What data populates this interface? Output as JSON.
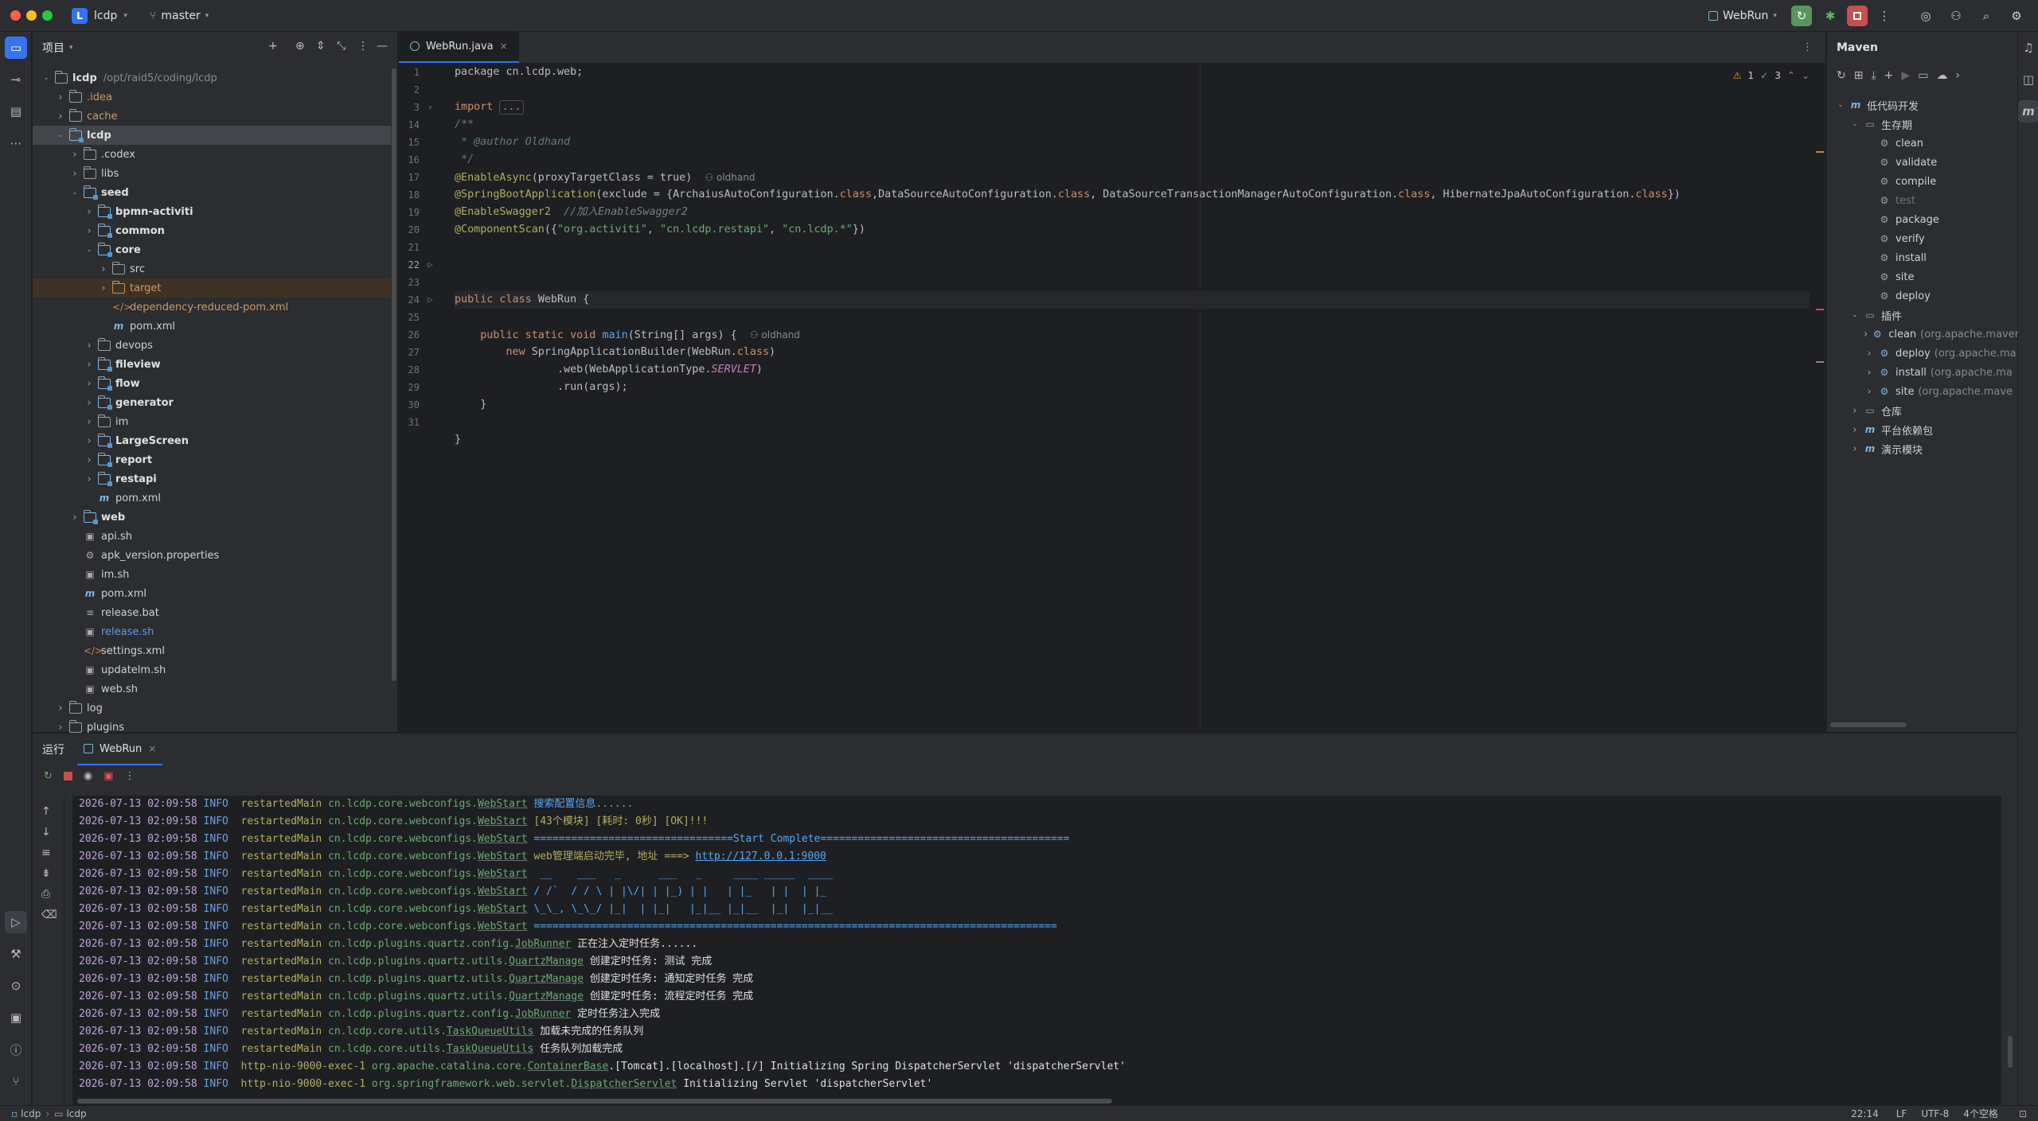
{
  "titlebar": {
    "project_badge": "L",
    "project": "lcdp",
    "branch": "master",
    "run_config": "WebRun"
  },
  "project_panel": {
    "title": "项目"
  },
  "tree": [
    {
      "d": 0,
      "a": "v",
      "t": "dir",
      "label": "lcdp",
      "path": "/opt/raid5/coding/lcdp",
      "b": true
    },
    {
      "d": 1,
      "a": ">",
      "t": "dir",
      "label": ".idea",
      "c": "orange"
    },
    {
      "d": 1,
      "a": ">",
      "t": "dir",
      "label": "cache",
      "c": "orange"
    },
    {
      "d": 1,
      "a": "v",
      "t": "mod",
      "label": "lcdp",
      "b": true,
      "sel": true
    },
    {
      "d": 2,
      "a": ">",
      "t": "dir",
      "label": ".codex"
    },
    {
      "d": 2,
      "a": ">",
      "t": "dir",
      "label": "libs"
    },
    {
      "d": 2,
      "a": "v",
      "t": "mod",
      "label": "seed",
      "b": true
    },
    {
      "d": 3,
      "a": ">",
      "t": "mod",
      "label": "bpmn-activiti",
      "b": true
    },
    {
      "d": 3,
      "a": ">",
      "t": "mod",
      "label": "common",
      "b": true
    },
    {
      "d": 3,
      "a": "v",
      "t": "mod",
      "label": "core",
      "b": true
    },
    {
      "d": 4,
      "a": ">",
      "t": "dir",
      "label": "src"
    },
    {
      "d": 4,
      "a": ">",
      "t": "tgt",
      "label": "target",
      "c": "orange",
      "hl": true
    },
    {
      "d": 4,
      "a": "",
      "t": "xml",
      "label": "dependency-reduced-pom.xml",
      "c": "orange"
    },
    {
      "d": 4,
      "a": "",
      "t": "pom",
      "label": "pom.xml"
    },
    {
      "d": 3,
      "a": ">",
      "t": "dir",
      "label": "devops"
    },
    {
      "d": 3,
      "a": ">",
      "t": "mod",
      "label": "fileview",
      "b": true
    },
    {
      "d": 3,
      "a": ">",
      "t": "mod",
      "label": "flow",
      "b": true
    },
    {
      "d": 3,
      "a": ">",
      "t": "mod",
      "label": "generator",
      "b": true
    },
    {
      "d": 3,
      "a": ">",
      "t": "dir",
      "label": "im"
    },
    {
      "d": 3,
      "a": ">",
      "t": "mod",
      "label": "LargeScreen",
      "b": true
    },
    {
      "d": 3,
      "a": ">",
      "t": "mod",
      "label": "report",
      "b": true
    },
    {
      "d": 3,
      "a": ">",
      "t": "mod",
      "label": "restapi",
      "b": true
    },
    {
      "d": 3,
      "a": "",
      "t": "pom",
      "label": "pom.xml"
    },
    {
      "d": 2,
      "a": ">",
      "t": "mod",
      "label": "web",
      "b": true
    },
    {
      "d": 2,
      "a": "",
      "t": "sh",
      "label": "api.sh"
    },
    {
      "d": 2,
      "a": "",
      "t": "props",
      "label": "apk_version.properties"
    },
    {
      "d": 2,
      "a": "",
      "t": "sh",
      "label": "im.sh"
    },
    {
      "d": 2,
      "a": "",
      "t": "pom",
      "label": "pom.xml"
    },
    {
      "d": 2,
      "a": "",
      "t": "txt",
      "label": "release.bat"
    },
    {
      "d": 2,
      "a": "",
      "t": "sh",
      "label": "release.sh",
      "c": "blue"
    },
    {
      "d": 2,
      "a": "",
      "t": "xml",
      "label": "settings.xml"
    },
    {
      "d": 2,
      "a": "",
      "t": "sh",
      "label": "updatelm.sh"
    },
    {
      "d": 2,
      "a": "",
      "t": "sh",
      "label": "web.sh"
    },
    {
      "d": 1,
      "a": ">",
      "t": "dir",
      "label": "log"
    },
    {
      "d": 1,
      "a": ">",
      "t": "dir",
      "label": "plugins"
    }
  ],
  "editor": {
    "tab": "WebRun.java",
    "inspections": {
      "warnings": "1",
      "ok": "3"
    },
    "line_numbers": [
      "1",
      "2",
      "3",
      "14",
      "15",
      "16",
      "17",
      "18",
      "19",
      "20",
      "21",
      "22",
      "23",
      "24",
      "25",
      "26",
      "27",
      "28",
      "29",
      "30",
      "31"
    ],
    "code": {
      "l1": "package cn.lcdp.web;",
      "l3_kw": "import",
      "l3_fold": "...",
      "l14": "/**",
      "l15": " * @author Oldhand",
      "l16": " */",
      "l17_an": "@EnableAsync",
      "l17_rest": "(proxyTargetClass = true)",
      "l17_author": "oldhand",
      "l18_an": "@SpringBootApplication",
      "l18_a": "(exclude = {ArchaiusAutoConfiguration.",
      "l18_b": ",DataSourceAutoConfiguration.",
      "l18_c": ", DataSourceTransactionManagerAutoConfiguration.",
      "l18_d": ", HibernateJpaAutoConfiguration.",
      "l18_e": "})",
      "class_kw": "class",
      "l19_an": "@EnableSwagger2",
      "l19_cm": "//加入EnableSwagger2",
      "l20_an": "@ComponentScan",
      "l20_a": "({",
      "l20_s1": "\"org.activiti\"",
      "l20_s2": "\"cn.lcdp.restapi\"",
      "l20_s3": "\"cn.lcdp.*\"",
      "l20_e": "})",
      "l22_kw": "public class",
      "l22_name": "WebRun",
      "l22_e": " {",
      "l24_kw": "public static void",
      "l24_fn": "main",
      "l24_e": "(String[] args) {",
      "l24_author": "oldhand",
      "l25_kw": "new",
      "l25_a": " SpringApplicationBuilder(WebRun.",
      "l25_e": ")",
      "l26_a": ".web(WebApplicationType.",
      "l26_c": "SERVLET",
      "l26_e": ")",
      "l27": ".run(args);",
      "l28": "}",
      "l30": "}"
    }
  },
  "maven": {
    "title": "Maven",
    "tree": [
      {
        "d": 0,
        "a": "v",
        "i": "m",
        "label": "低代码开发"
      },
      {
        "d": 1,
        "a": "v",
        "i": "dir",
        "label": "生存期"
      },
      {
        "d": 2,
        "i": "gear",
        "label": "clean"
      },
      {
        "d": 2,
        "i": "gear",
        "label": "validate"
      },
      {
        "d": 2,
        "i": "gear",
        "label": "compile"
      },
      {
        "d": 2,
        "i": "gear",
        "label": "test",
        "dim": true
      },
      {
        "d": 2,
        "i": "gear",
        "label": "package"
      },
      {
        "d": 2,
        "i": "gear",
        "label": "verify"
      },
      {
        "d": 2,
        "i": "gear",
        "label": "install"
      },
      {
        "d": 2,
        "i": "gear",
        "label": "site"
      },
      {
        "d": 2,
        "i": "gear",
        "label": "deploy"
      },
      {
        "d": 1,
        "a": "v",
        "i": "dir",
        "label": "插件"
      },
      {
        "d": 2,
        "a": ">",
        "i": "plug",
        "label": "clean",
        "sub": "(org.apache.maven"
      },
      {
        "d": 2,
        "a": ">",
        "i": "plug",
        "label": "deploy",
        "sub": "(org.apache.ma"
      },
      {
        "d": 2,
        "a": ">",
        "i": "plug",
        "label": "install",
        "sub": "(org.apache.ma"
      },
      {
        "d": 2,
        "a": ">",
        "i": "plug",
        "label": "site",
        "sub": "(org.apache.mave"
      },
      {
        "d": 1,
        "a": ">",
        "i": "dir",
        "label": "仓库"
      },
      {
        "d": 1,
        "a": ">",
        "i": "m",
        "label": "平台依赖包"
      },
      {
        "d": 1,
        "a": ">",
        "i": "m",
        "label": "演示模块"
      }
    ]
  },
  "run": {
    "title": "运行",
    "tab": "WebRun",
    "logs": [
      {
        "ts": "2026-07-13 02:09:58",
        "lv": "INFO",
        "th": "restartedMain",
        "cls": "cn.lcdp.core.webconfigs.",
        "u": "WebStart",
        "msg": " 搜索配置信息......",
        "mc": "ban"
      },
      {
        "ts": "2026-07-13 02:09:58",
        "lv": "INFO",
        "th": "restartedMain",
        "cls": "cn.lcdp.core.webconfigs.",
        "u": "WebStart",
        "msg": " [43个模块] [耗时: 0秒] [OK]!!!",
        "mc": "th"
      },
      {
        "ts": "2026-07-13 02:09:58",
        "lv": "INFO",
        "th": "restartedMain",
        "cls": "cn.lcdp.core.webconfigs.",
        "u": "WebStart",
        "msg": " ================================Start Complete========================================",
        "mc": "ban"
      },
      {
        "ts": "2026-07-13 02:09:58",
        "lv": "INFO",
        "th": "restartedMain",
        "cls": "cn.lcdp.core.webconfigs.",
        "u": "WebStart",
        "msg": " web管理端启动完毕, 地址 ===> ",
        "mc": "th",
        "url": "http://127.0.0.1:9000"
      },
      {
        "ts": "2026-07-13 02:09:58",
        "lv": "INFO",
        "th": "restartedMain",
        "cls": "cn.lcdp.core.webconfigs.",
        "u": "WebStart",
        "msg": "  __    ___   _      ___   _     ____ _____  ____",
        "mc": "ban"
      },
      {
        "ts": "2026-07-13 02:09:58",
        "lv": "INFO",
        "th": "restartedMain",
        "cls": "cn.lcdp.core.webconfigs.",
        "u": "WebStart",
        "msg": " / /`  / / \\ | |\\/| | |_) | |   | |_   | |  | |_",
        "mc": "ban"
      },
      {
        "ts": "2026-07-13 02:09:58",
        "lv": "INFO",
        "th": "restartedMain",
        "cls": "cn.lcdp.core.webconfigs.",
        "u": "WebStart",
        "msg": " \\_\\_, \\_\\_/ |_|  | |_|   |_|__ |_|__  |_|  |_|__",
        "mc": "ban"
      },
      {
        "ts": "2026-07-13 02:09:58",
        "lv": "INFO",
        "th": "restartedMain",
        "cls": "cn.lcdp.core.webconfigs.",
        "u": "WebStart",
        "msg": " ====================================================================================",
        "mc": "ban"
      },
      {
        "ts": "2026-07-13 02:09:58",
        "lv": "INFO",
        "th": "restartedMain",
        "cls": "cn.lcdp.plugins.quartz.config.",
        "u": "JobRunner",
        "msg": " 正在注入定时任务......",
        "mc": "msg"
      },
      {
        "ts": "2026-07-13 02:09:58",
        "lv": "INFO",
        "th": "restartedMain",
        "cls": "cn.lcdp.plugins.quartz.utils.",
        "u": "QuartzManage",
        "msg": " 创建定时任务: 测试 完成",
        "mc": "msg"
      },
      {
        "ts": "2026-07-13 02:09:58",
        "lv": "INFO",
        "th": "restartedMain",
        "cls": "cn.lcdp.plugins.quartz.utils.",
        "u": "QuartzManage",
        "msg": " 创建定时任务: 通知定时任务 完成",
        "mc": "msg"
      },
      {
        "ts": "2026-07-13 02:09:58",
        "lv": "INFO",
        "th": "restartedMain",
        "cls": "cn.lcdp.plugins.quartz.utils.",
        "u": "QuartzManage",
        "msg": " 创建定时任务: 流程定时任务 完成",
        "mc": "msg"
      },
      {
        "ts": "2026-07-13 02:09:58",
        "lv": "INFO",
        "th": "restartedMain",
        "cls": "cn.lcdp.plugins.quartz.config.",
        "u": "JobRunner",
        "msg": " 定时任务注入完成",
        "mc": "msg"
      },
      {
        "ts": "2026-07-13 02:09:58",
        "lv": "INFO",
        "th": "restartedMain",
        "cls": "cn.lcdp.core.utils.",
        "u": "TaskQueueUtils",
        "msg": " 加载未完成的任务队列",
        "mc": "msg"
      },
      {
        "ts": "2026-07-13 02:09:58",
        "lv": "INFO",
        "th": "restartedMain",
        "cls": "cn.lcdp.core.utils.",
        "u": "TaskQueueUtils",
        "msg": " 任务队列加载完成",
        "mc": "msg"
      },
      {
        "ts": "2026-07-13 02:09:58",
        "lv": "INFO",
        "th": "http-nio-9000-exec-1",
        "cls": "org.apache.catalina.core.",
        "u": "ContainerBase",
        "msg": ".[Tomcat].[localhost].[/] Initializing Spring DispatcherServlet 'dispatcherServlet'",
        "mc": "msg"
      },
      {
        "ts": "2026-07-13 02:09:58",
        "lv": "INFO",
        "th": "http-nio-9000-exec-1",
        "cls": "org.springframework.web.servlet.",
        "u": "DispatcherServlet",
        "msg": " Initializing Servlet 'dispatcherServlet'",
        "mc": "msg"
      }
    ]
  },
  "status": {
    "crumb1": "lcdp",
    "crumb2": "lcdp",
    "position": "22:14",
    "line_sep": "LF",
    "encoding": "UTF-8",
    "indent": "4个空格"
  },
  "colors": {
    "accent": "#3574f0",
    "run_green": "#57965c",
    "stop_red": "#e55353"
  }
}
